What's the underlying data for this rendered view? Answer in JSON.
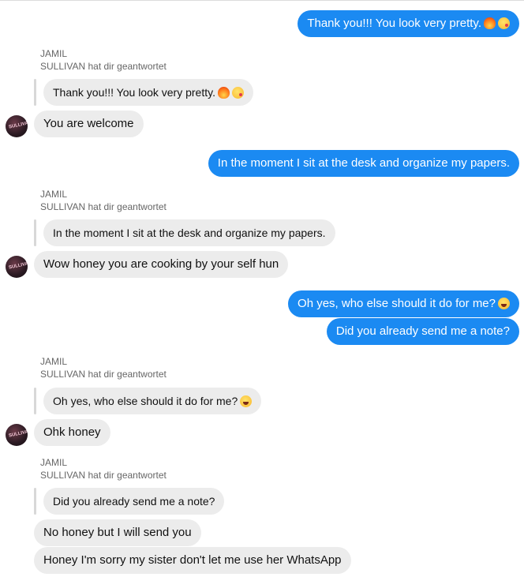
{
  "thread": {
    "sender_first": "JAMIL",
    "reply_line": "SULLIVAN hat dir geantwortet",
    "avatar_tag": "SULLIVA",
    "messages": [
      {
        "text": "Thank you!!! You look very pretty.",
        "emoji": [
          "fire-emoji",
          "wink-kiss-emoji"
        ]
      },
      {
        "quote": "Thank you!!! You look very pretty.",
        "emoji": [
          "fire-emoji",
          "wink-kiss-emoji"
        ]
      },
      {
        "text": "You are welcome"
      },
      {
        "text": "In the moment I sit at the desk and organize my papers."
      },
      {
        "quote": "In the moment I sit at the desk and organize my papers."
      },
      {
        "text": "Wow honey you are cooking by your self hun"
      },
      {
        "text": "Oh yes, who else should it do for me?",
        "emoji": [
          "laughing-emoji"
        ]
      },
      {
        "text": "Did you already send me a note?"
      },
      {
        "quote": "Oh yes, who else should it do for me?",
        "emoji": [
          "laughing-emoji"
        ]
      },
      {
        "text": "Ohk honey"
      },
      {
        "quote": "Did you already send me a note?"
      },
      {
        "text": "No honey but I will send you"
      },
      {
        "text": "Honey I'm sorry my sister don't let me use her WhatsApp"
      }
    ]
  },
  "colors": {
    "outgoing": "#1b8af2",
    "incoming": "#ececec"
  }
}
